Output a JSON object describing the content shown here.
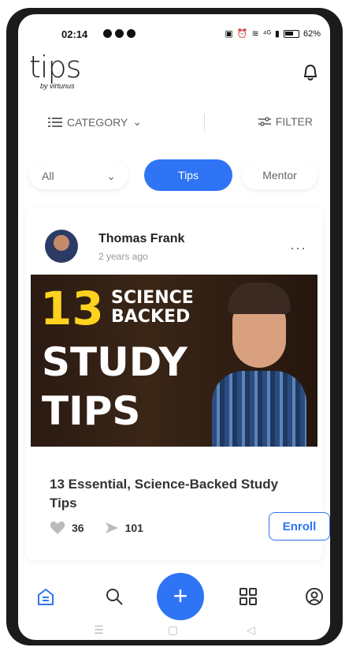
{
  "status_bar": {
    "time": "02:14",
    "network": "⁴ᴳ",
    "battery": "62%"
  },
  "header": {
    "logo_main": "tips",
    "logo_sub": "by virtunus",
    "bell_icon": "bell-icon"
  },
  "filters": {
    "category_label": "CATEGORY",
    "filter_label": "FILTER"
  },
  "tabs": {
    "all_label": "All",
    "tips_label": "Tips",
    "mentor_label": "Mentor"
  },
  "post": {
    "author": "Thomas Frank",
    "time_ago": "2 years ago",
    "more_label": "···",
    "thumb_number": "13",
    "thumb_science": "SCIENCE",
    "thumb_backed": "BACKED",
    "thumb_study": "STUDY",
    "thumb_tips": "TIPS",
    "title": "13 Essential, Science-Backed Study Tips",
    "likes": "36",
    "shares": "101",
    "enroll_label": "Enroll"
  },
  "bottom_nav": {
    "add_label": "+"
  },
  "colors": {
    "accent": "#2f74f5",
    "thumb_yellow": "#ffd21f"
  }
}
